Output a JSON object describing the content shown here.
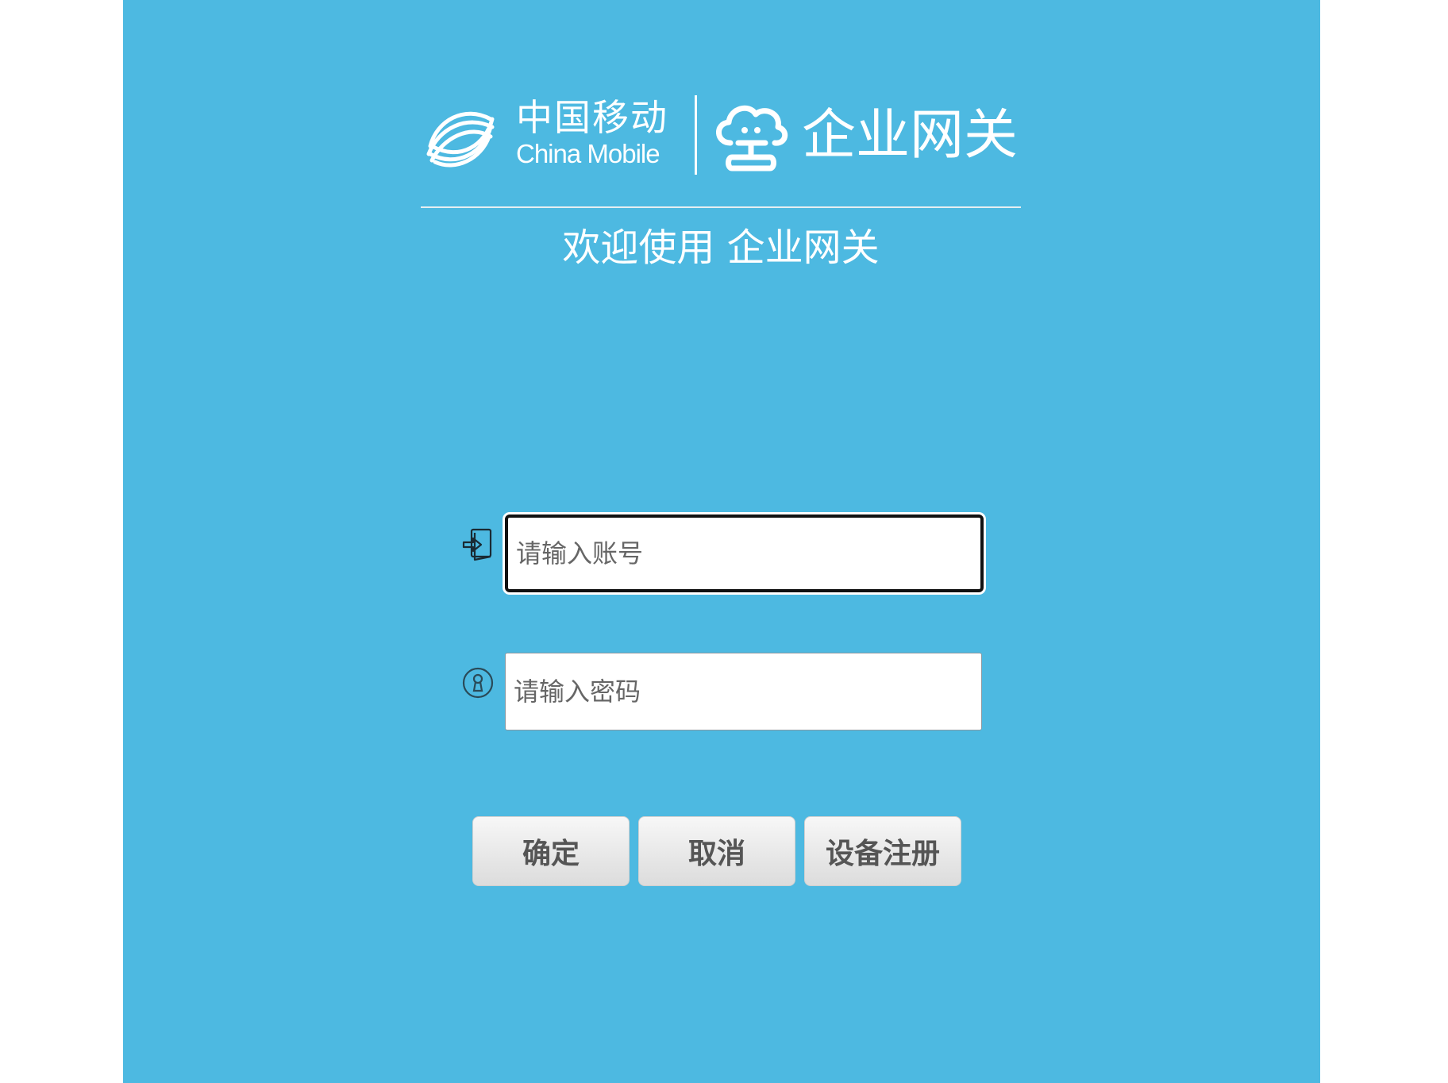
{
  "logo": {
    "brand_cn": "中国移动",
    "brand_en": "China Mobile",
    "product": "企业网关",
    "icons": [
      "china-mobile-emblem-icon",
      "cloud-gateway-icon"
    ]
  },
  "welcome_text": "欢迎使用 企业网关",
  "form": {
    "account": {
      "placeholder": "请输入账号",
      "icon": "login-icon",
      "value": ""
    },
    "password": {
      "placeholder": "请输入密码",
      "icon": "lock-icon",
      "value": ""
    }
  },
  "buttons": {
    "ok": "确定",
    "cancel": "取消",
    "register": "设备注册"
  },
  "colors": {
    "background": "#4db9e1",
    "text": "#ffffff",
    "button_text": "#555555"
  }
}
